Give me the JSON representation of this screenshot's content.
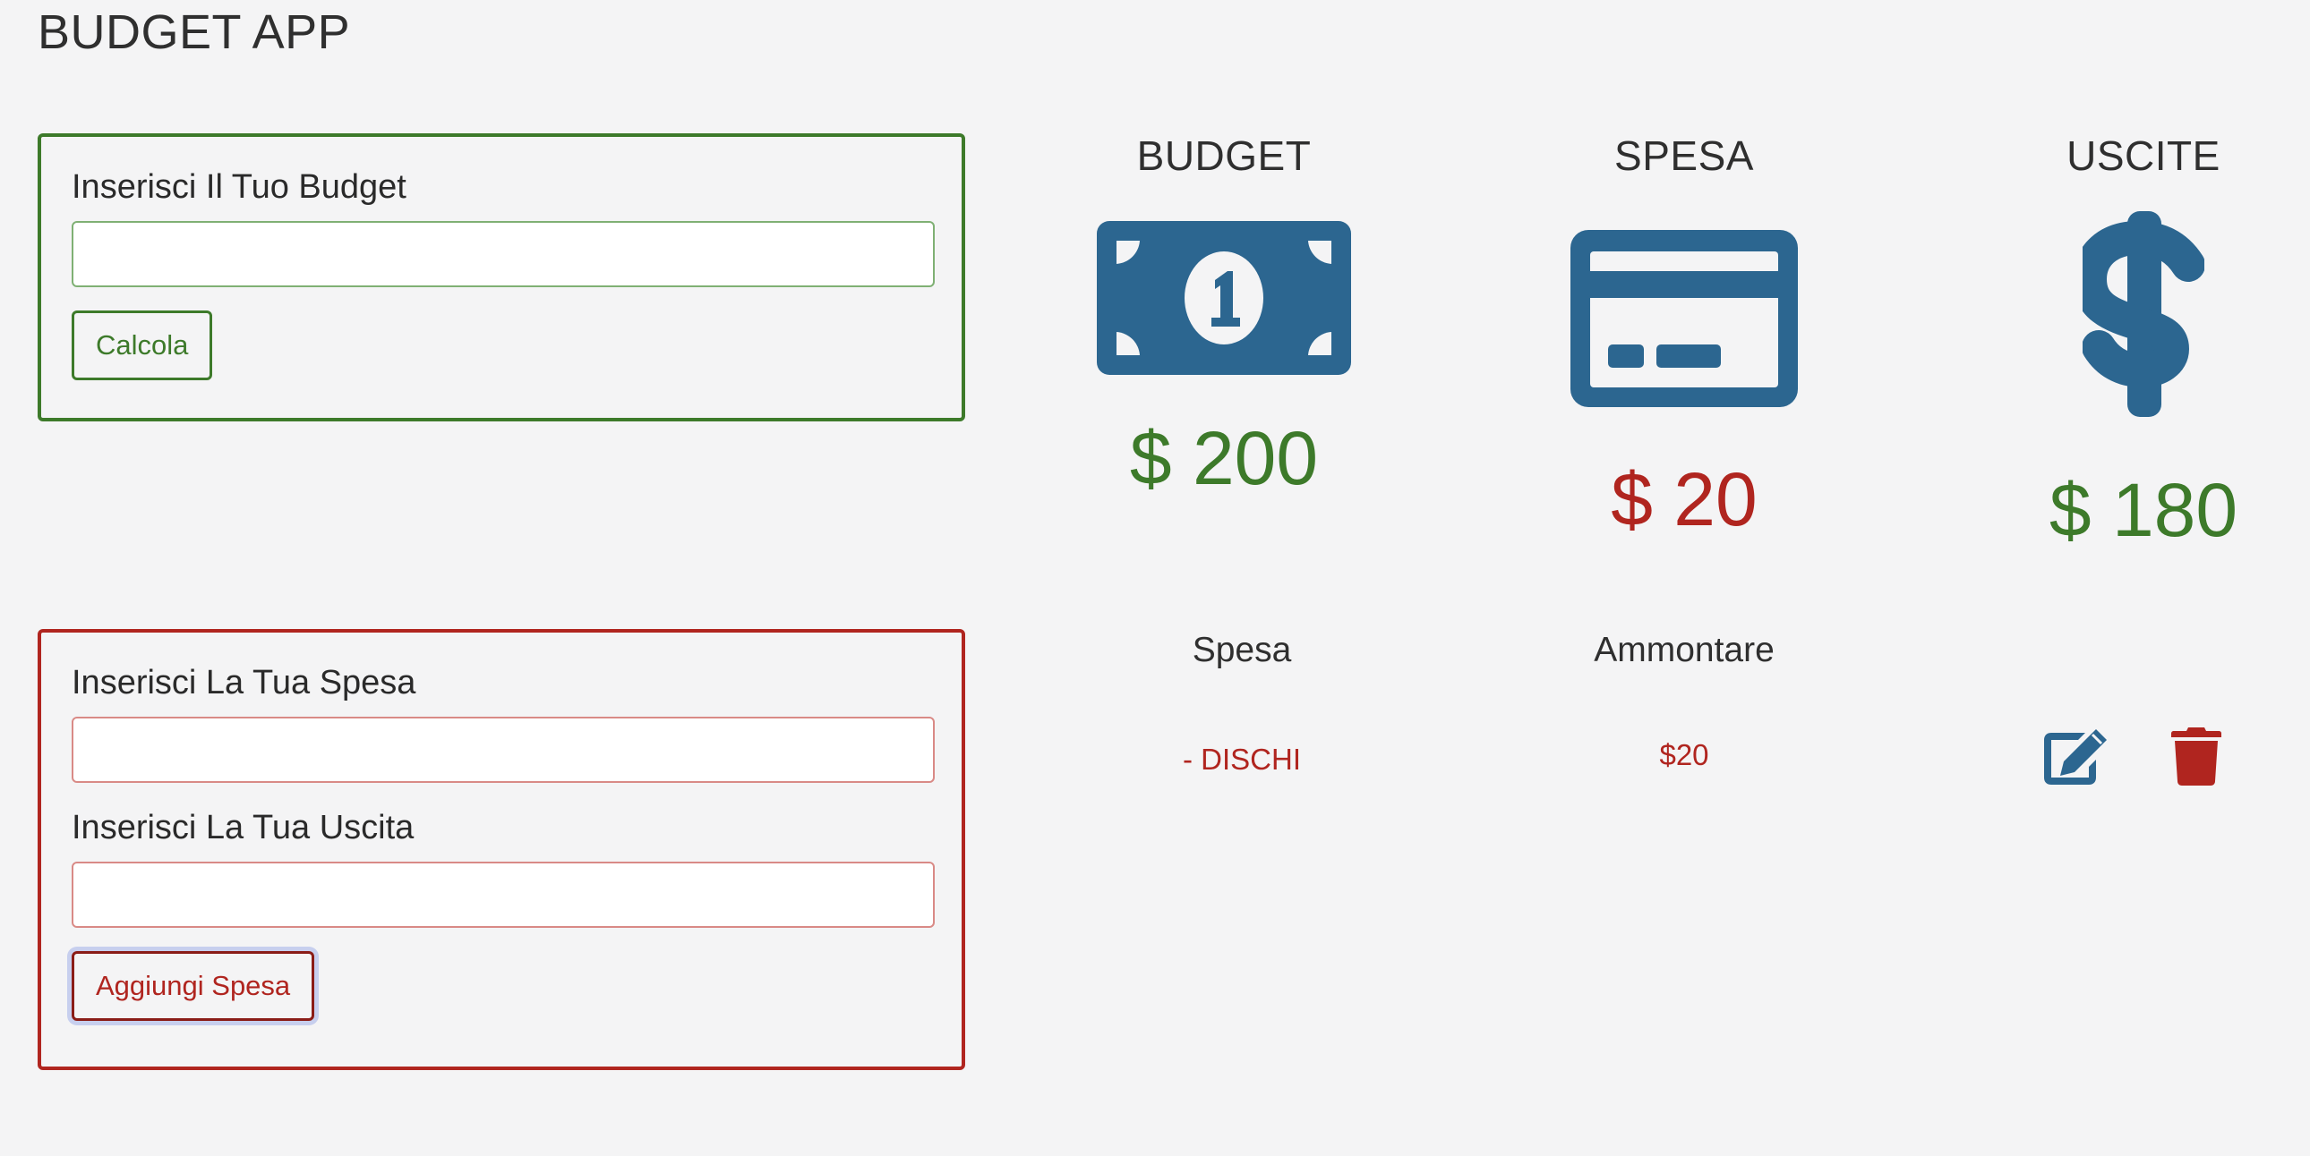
{
  "app": {
    "title": "BUDGET APP"
  },
  "budget_form": {
    "label": "Inserisci Il Tuo Budget",
    "value": "",
    "placeholder": "",
    "submit_label": "Calcola"
  },
  "expense_form": {
    "name_label": "Inserisci La Tua Spesa",
    "name_value": "",
    "amount_label": "Inserisci La Tua Uscita",
    "amount_value": "",
    "submit_label": "Aggiungi Spesa"
  },
  "summary": {
    "budget": {
      "title": "BUDGET",
      "amount": "$ 200",
      "icon": "banknote-icon"
    },
    "expense": {
      "title": "SPESA",
      "amount": "$ 20",
      "icon": "credit-card-icon"
    },
    "balance": {
      "title": "USCITE",
      "amount": "$ 180",
      "icon": "dollar-sign-icon"
    }
  },
  "expense_list": {
    "headers": {
      "name": "Spesa",
      "amount": "Ammontare"
    },
    "items": [
      {
        "name": "- DISCHI",
        "amount": "$20"
      }
    ]
  },
  "colors": {
    "background": "#f4f4f5",
    "success": "#3d7a2a",
    "danger": "#b0251f",
    "icon_blue": "#2c6690"
  }
}
